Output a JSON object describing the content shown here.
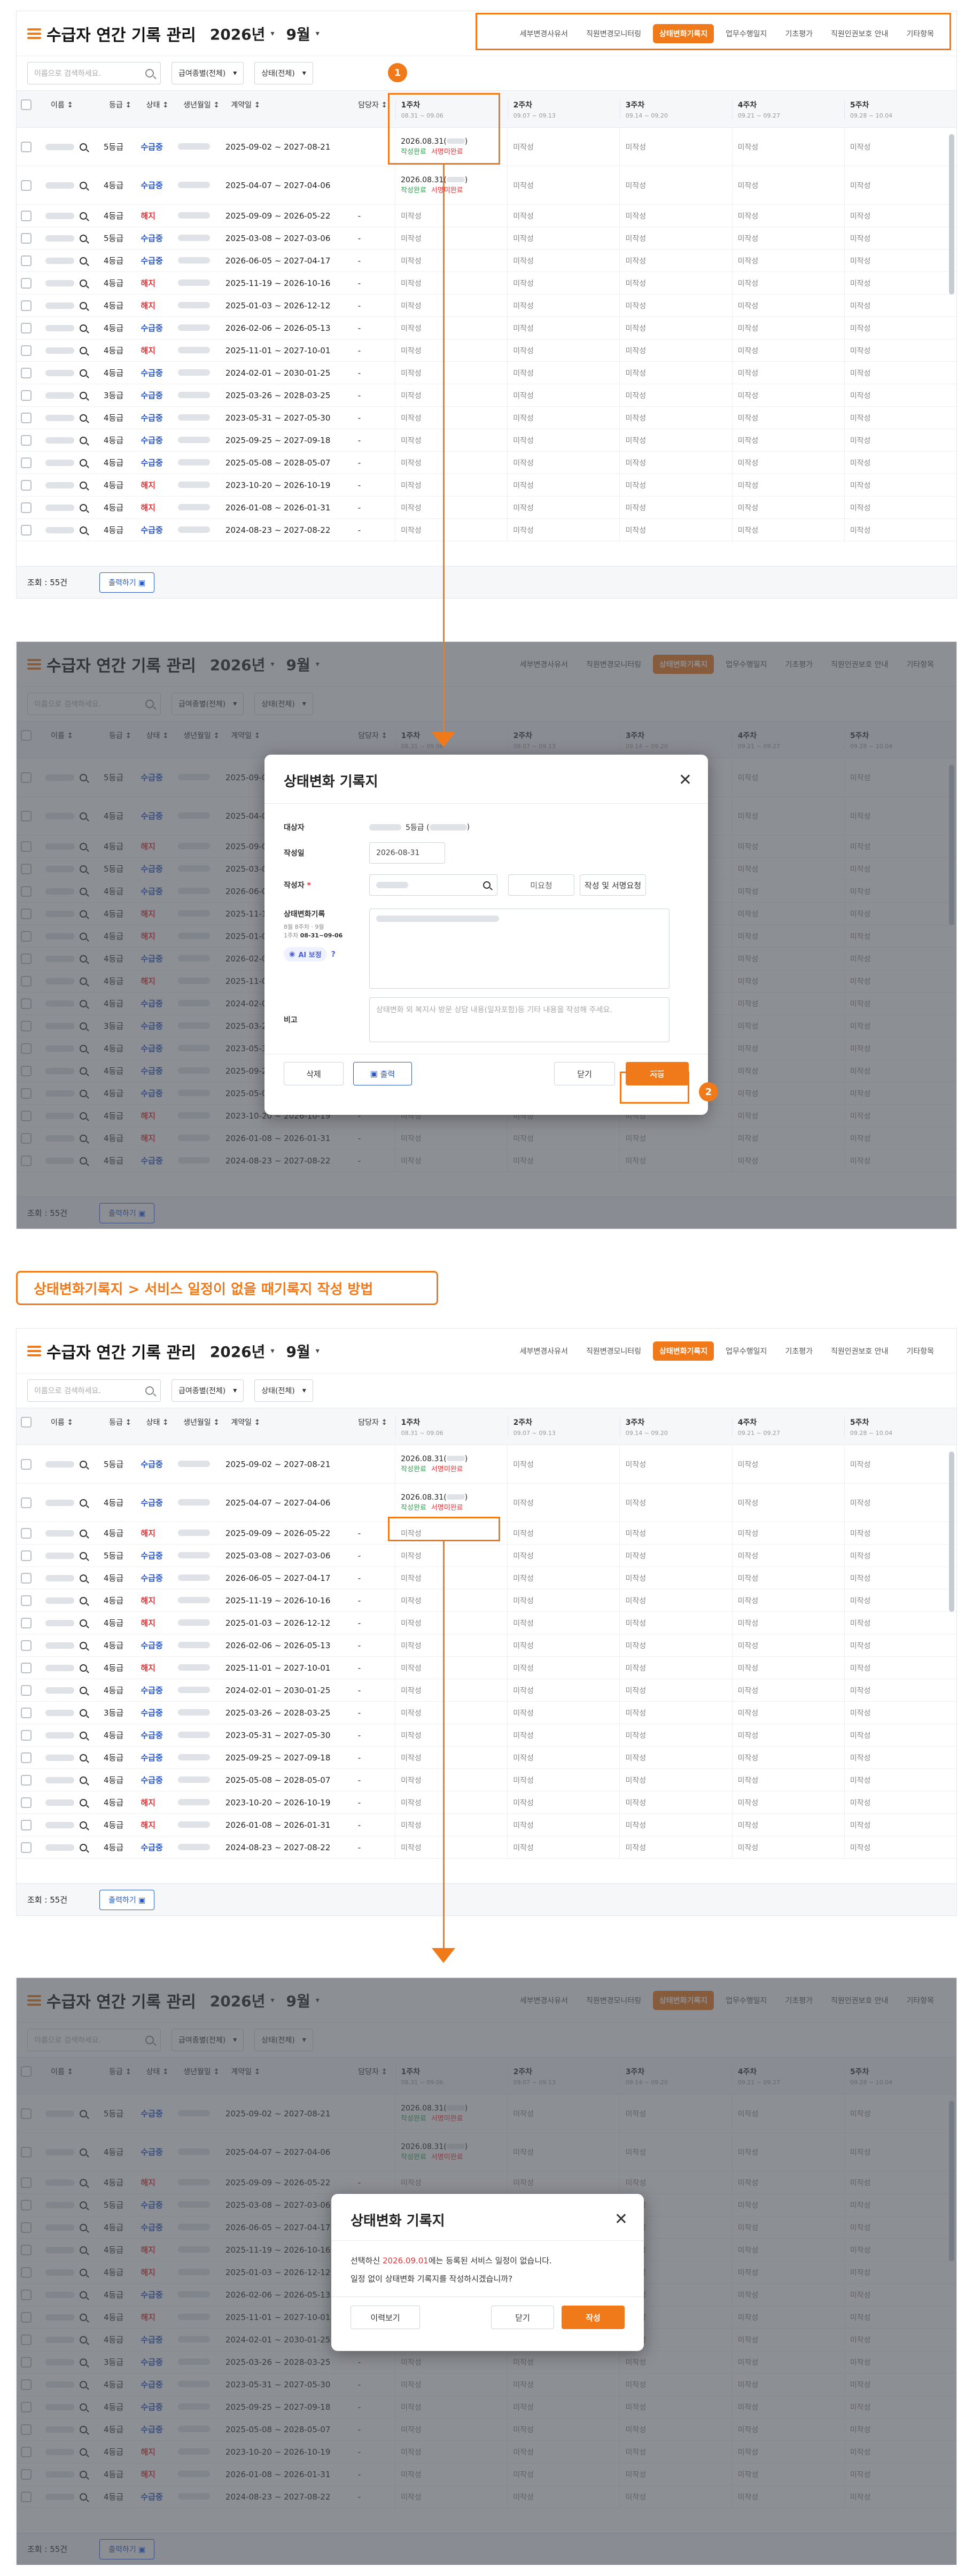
{
  "app": {
    "title": "수급자 연간 기록 관리",
    "year": "2026년",
    "month": "9월",
    "caret": "▾"
  },
  "tabs": [
    "세부변경사유서",
    "직원변경모니터링",
    "상태변화기록지",
    "업무수행일지",
    "기초평가",
    "직원인권보호 안내",
    "기타항목"
  ],
  "filters": {
    "search_placeholder": "이름으로 검색하세요.",
    "wage_select": "급여종별(전체)",
    "status_select": "상태(전체)"
  },
  "columns": {
    "name": "이름",
    "grade": "등급",
    "status": "상태",
    "birth": "생년월일",
    "contract": "계약일",
    "manager": "담당자",
    "sort": "↕"
  },
  "weeks": [
    {
      "label": "1주차",
      "range": "08.31 ~ 09.06"
    },
    {
      "label": "2주차",
      "range": "09.07 ~ 09.13"
    },
    {
      "label": "3주차",
      "range": "09.14 ~ 09.20"
    },
    {
      "label": "4주차",
      "range": "09.21 ~ 09.27"
    },
    {
      "label": "5주차",
      "range": "09.28 ~ 10.04"
    }
  ],
  "rows": [
    {
      "grade": "5등급",
      "status": "수급중",
      "contract": "2025-09-02 ~ 2027-08-21"
    },
    {
      "grade": "4등급",
      "status": "수급중",
      "contract": "2025-04-07 ~ 2027-04-06"
    },
    {
      "grade": "4등급",
      "status": "해지",
      "contract": "2025-09-09 ~ 2026-05-22"
    },
    {
      "grade": "5등급",
      "status": "수급중",
      "contract": "2025-03-08 ~ 2027-03-06"
    },
    {
      "grade": "4등급",
      "status": "수급중",
      "contract": "2026-06-05 ~ 2027-04-17"
    },
    {
      "grade": "4등급",
      "status": "해지",
      "contract": "2025-11-19 ~ 2026-10-16"
    },
    {
      "grade": "4등급",
      "status": "해지",
      "contract": "2025-01-03 ~ 2026-12-12"
    },
    {
      "grade": "4등급",
      "status": "수급중",
      "contract": "2026-02-06 ~ 2026-05-13"
    },
    {
      "grade": "4등급",
      "status": "해지",
      "contract": "2025-11-01 ~ 2027-10-01"
    },
    {
      "grade": "4등급",
      "status": "수급중",
      "contract": "2024-02-01 ~ 2030-01-25"
    },
    {
      "grade": "3등급",
      "status": "수급중",
      "contract": "2025-03-26 ~ 2028-03-25"
    },
    {
      "grade": "4등급",
      "status": "수급중",
      "contract": "2023-05-31 ~ 2027-05-30"
    },
    {
      "grade": "4등급",
      "status": "수급중",
      "contract": "2025-09-25 ~ 2027-09-18"
    },
    {
      "grade": "4등급",
      "status": "수급중",
      "contract": "2025-05-08 ~ 2028-05-07"
    },
    {
      "grade": "4등급",
      "status": "해지",
      "contract": "2023-10-20 ~ 2026-10-19"
    },
    {
      "grade": "4등급",
      "status": "해지",
      "contract": "2026-01-08 ~ 2026-01-31"
    },
    {
      "grade": "4등급",
      "status": "수급중",
      "contract": "2024-08-23 ~ 2027-08-22"
    }
  ],
  "cells": {
    "unwritten": "미작성",
    "date1": "2026.08.31(",
    "date1_close": ")",
    "done": "작성완료",
    "sign_done": "서명미완료",
    "dash": "-"
  },
  "footer": {
    "count": "조회 : 55건",
    "print": "출력하기"
  },
  "badges": {
    "one": "1",
    "two": "2"
  },
  "modal1": {
    "title": "상태변화 기록지",
    "close": "✕",
    "target_label": "대상자",
    "target_value": "5등급 (",
    "target_close": ")",
    "date_label": "작성일",
    "date_value": "2026-08-31",
    "writer_label": "작성자",
    "required": "*",
    "unrequested": "미요청",
    "write_sign": "작성 및 서명요청",
    "record_label": "상태변화기록",
    "record_sub1": "8월 8주차 · 9월",
    "record_sub2": "1주차",
    "record_range": "08-31~09-06",
    "ai": "AI 보정",
    "help": "?",
    "note_label": "비고",
    "note_placeholder": "상태변화 외 복지사 방문 상담 내용(일자포함)등 기타 내용을 작성해 주세요.",
    "delete": "삭제",
    "print": "출력",
    "cancel": "닫기",
    "save": "저장"
  },
  "caption": "상태변화기록지 > 서비스 일정이 없을 때기록지 작성 방법",
  "modal2": {
    "title": "상태변화 기록지",
    "close": "✕",
    "line1_pre": "선택하신 ",
    "line1_date": "2026.09.01",
    "line1_post": "에는 등록된 서비스 일정이 없습니다.",
    "line2": "일정 없이 상태변화 기록지를 작성하시겠습니까?",
    "history": "이력보기",
    "cancel": "닫기",
    "write": "작성"
  },
  "colors": {
    "accent": "#f07a1a",
    "blue": "#2a58c9",
    "red": "#e0373b",
    "green": "#2aa64d"
  }
}
